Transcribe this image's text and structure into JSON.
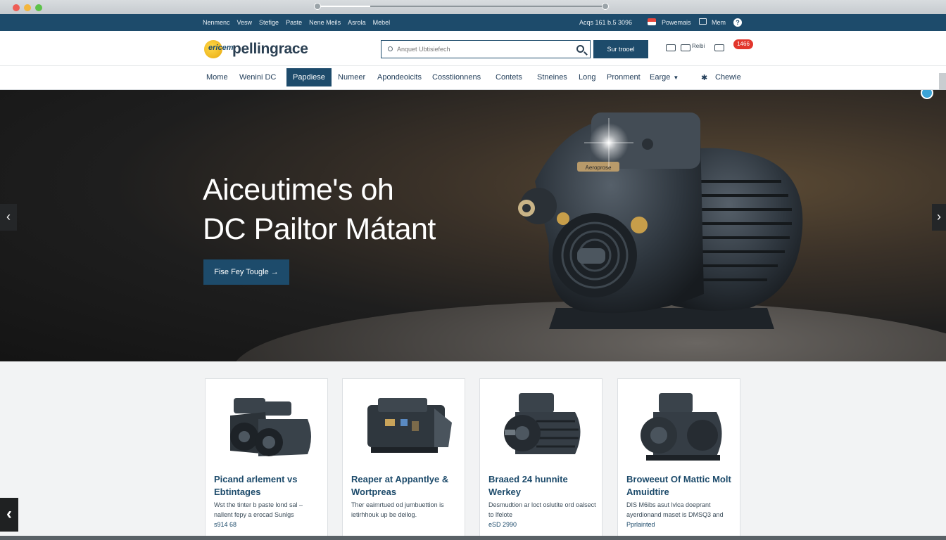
{
  "browser": {
    "playback_progress": 0.18
  },
  "topbar": {
    "links": [
      "Nenmenc",
      "Vesw",
      "Stefige",
      "Paste",
      "Nene Meils",
      "Asrola",
      "Mebel"
    ],
    "hours": "Acqs 161 b.5 3096",
    "language": "Powemais",
    "messages": "Mem",
    "help": "?"
  },
  "header": {
    "logo_mark": "ericem",
    "logo_text": "pellingrace",
    "search_placeholder": "Anquet Ubtisiefech",
    "search_button": "Sur trooel",
    "util_1": "Reibi",
    "cart_badge": "1466"
  },
  "nav": {
    "items": [
      "Mome",
      "Wenini DC",
      "Papdiese",
      "Numeer",
      "Apondeoicits",
      "Cosstiionnens",
      "Contets",
      "Stneines",
      "Long",
      "Pronment",
      "Earge"
    ],
    "active_index": 2,
    "contact": "Chewie"
  },
  "hero": {
    "title_line1": "Aiceutime's oh",
    "title_line2": "DC Pailtor Mátant",
    "cta": "Fise Fey Tougle →",
    "motor_plate": "Aeroprose",
    "prev": "‹",
    "next": "›"
  },
  "products": [
    {
      "title": "Picand arlement vs Ebtintages",
      "desc": "Wst the tinter b paste lond sal – nallent fepy a erocad Sunlgs",
      "price": "s914 68"
    },
    {
      "title": "Reaper at Appantlye & Wortpreas",
      "desc": "Ther eaimrtued od jumbuettion is ietirhhouk up be deilog.",
      "price": ""
    },
    {
      "title": "Braaed 24 hunnite Werkey",
      "desc": "Desmudtion ar loct oslutite ord oalsect to lfelote",
      "price": "eSD 2990"
    },
    {
      "title": "Broweeut Of Mattic Molt Amuidtire",
      "desc": "DIS M6ibs asut lvlca doeprant ayerdionand maset is DMSQ3 and",
      "price": "Pprlainted"
    }
  ],
  "colors": {
    "primary": "#1d4b6b",
    "accent_badge": "#e2362c",
    "logo_gold": "#f2be25"
  }
}
